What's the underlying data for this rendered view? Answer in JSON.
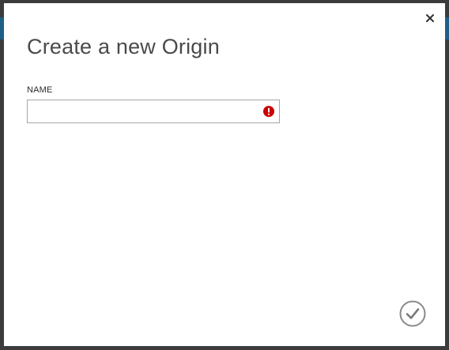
{
  "dialog": {
    "title": "Create a new Origin",
    "close_icon": "close-icon",
    "confirm_icon": "checkmark-circle-icon"
  },
  "form": {
    "name_field": {
      "label": "NAME",
      "value": "",
      "placeholder": "",
      "validation_state": "error",
      "validation_icon": "error-exclamation-icon"
    }
  },
  "colors": {
    "dialog_background": "#ffffff",
    "title_text": "#4a4a4a",
    "error_icon": "#cc0000",
    "confirm_icon": "#8a8a8a",
    "backdrop": "#3c3c3c",
    "accent_band": "#1e5f88"
  }
}
